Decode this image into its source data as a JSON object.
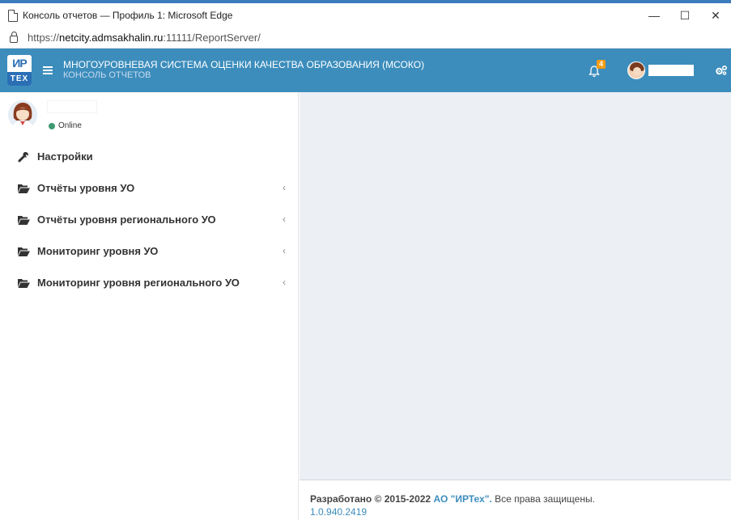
{
  "window": {
    "title": "Консоль отчетов — Профиль 1: Microsoft Edge",
    "minimize": "—",
    "maximize": "☐",
    "close": "✕"
  },
  "address": {
    "protocol": "https://",
    "host": "netcity.admsakhalin.ru",
    "port_path": ":11111/ReportServer/"
  },
  "header": {
    "logo_top": "ИР",
    "logo_bottom": "ТЕХ",
    "title": "МНОГОУРОВНЕВАЯ СИСТЕМА ОЦЕНКИ КАЧЕСТВА ОБРАЗОВАНИЯ (МСОКО)",
    "subtitle": "КОНСОЛЬ ОТЧЕТОВ",
    "notification_count": "4",
    "accent": "#3c8dbc"
  },
  "user": {
    "status": "Online",
    "status_color": "#3d9970"
  },
  "menu": {
    "items": [
      {
        "label": "Настройки",
        "icon": "wrench-icon"
      },
      {
        "label": "Отчёты уровня УО",
        "icon": "folder-open-icon"
      },
      {
        "label": "Отчёты уровня регионального УО",
        "icon": "folder-open-icon"
      },
      {
        "label": "Мониторинг уровня УО",
        "icon": "folder-open-icon"
      },
      {
        "label": "Мониторинг уровня регионального УО",
        "icon": "folder-open-icon"
      }
    ],
    "chevron": "‹"
  },
  "footer": {
    "developed": "Разработано © 2015-2022",
    "company": "АО \"ИРТех\".",
    "rights": "Все права защищены.",
    "version": "1.0.940.2419"
  }
}
